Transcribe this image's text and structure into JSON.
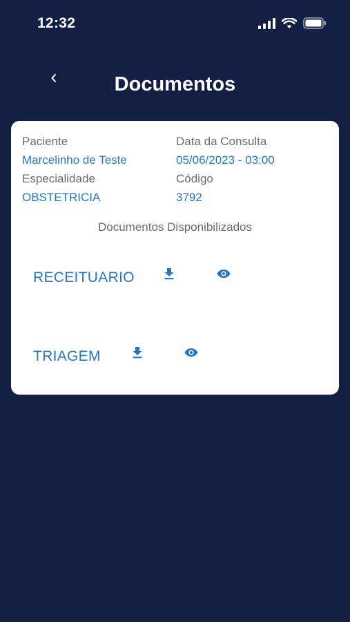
{
  "status_bar": {
    "time": "12:32",
    "icons": [
      "cellular-signal-icon",
      "wifi-icon",
      "battery-icon"
    ]
  },
  "header": {
    "title": "Documentos",
    "back_icon": "chevron-left-icon"
  },
  "details": {
    "patient_label": "Paciente",
    "patient_value": "Marcelinho de Teste",
    "date_label": "Data da Consulta",
    "date_value": "05/06/2023 - 03:00",
    "specialty_label": "Especialidade",
    "specialty_value": "OBSTETRICIA",
    "code_label": "Código",
    "code_value": "3792"
  },
  "documents": {
    "heading": "Documentos Disponibilizados",
    "items": [
      {
        "name": "RECEITUARIO",
        "download_icon": "download-icon",
        "view_icon": "eye-icon"
      },
      {
        "name": "TRIAGEM",
        "download_icon": "download-icon",
        "view_icon": "eye-icon"
      }
    ]
  },
  "colors": {
    "background": "#131f45",
    "card": "#ffffff",
    "accent": "#2a74c0",
    "label": "#6b6b6b"
  }
}
